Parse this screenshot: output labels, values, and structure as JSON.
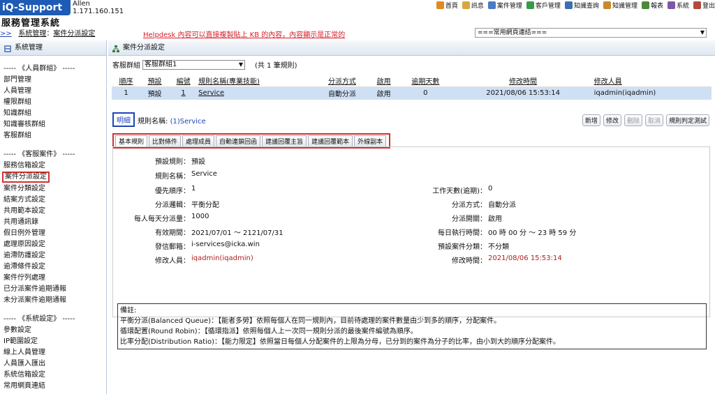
{
  "header": {
    "logo": "iQ-Support",
    "user_name": "Allen",
    "user_ip": "1.171.160.151",
    "app_title": "服務管理系統",
    "breadcrumb": {
      "arrows": ">>",
      "parent": "系統管理",
      "sep": "：",
      "current": "案件分派設定"
    },
    "notice": "Helpdesk 內容可以直接複製貼上 KB 的內容，內容顯示是正常的",
    "quicklinks": "===常用網頁連結===",
    "nav": [
      {
        "label": "首頁",
        "icon": "home-icon",
        "color": "#e08a20"
      },
      {
        "label": "訊息",
        "icon": "mail-icon",
        "color": "#d7a640"
      },
      {
        "label": "案件管理",
        "icon": "case-icon",
        "color": "#4a7bc4"
      },
      {
        "label": "客戶管理",
        "icon": "customer-icon",
        "color": "#3a9a4a"
      },
      {
        "label": "知識查詢",
        "icon": "search-icon",
        "color": "#3b6fb0"
      },
      {
        "label": "知識管理",
        "icon": "knowledge-icon",
        "color": "#c98a2c"
      },
      {
        "label": "報表",
        "icon": "report-icon",
        "color": "#4b8a3a"
      },
      {
        "label": "系統",
        "icon": "system-icon",
        "color": "#7a5aa8"
      },
      {
        "label": "登出",
        "icon": "logout-icon",
        "color": "#b04a3a"
      }
    ]
  },
  "sidebar": {
    "title": "系統管理",
    "groups": [
      {
        "title": "----- 《人員群組》 -----",
        "items": [
          "部門管理",
          "人員管理",
          "權限群組",
          "知識群組",
          "知識審核群組",
          "客服群組"
        ]
      },
      {
        "title": "----- 《客服案件》 -----",
        "items": [
          "服務信箱設定",
          "案件分派設定",
          "案件分類設定",
          "結案方式設定",
          "共用範本設定",
          "共用通訊錄",
          "假日例外管理",
          "處理原因設定",
          "逾滯防護設定",
          "逾滯條件設定",
          "案件佇列處理",
          "已分派案件逾期通報",
          "未分派案件逾期通報"
        ]
      },
      {
        "title": "----- 《系統設定》 -----",
        "items": [
          "參數設定",
          "IP範圍設定",
          "線上人員管理",
          "人員匯入匯出",
          "系統信箱設定",
          "常用網頁連結"
        ]
      }
    ],
    "active_item": "案件分派設定"
  },
  "main": {
    "title": "案件分派設定",
    "filter": {
      "label": "客服群組",
      "value": "客服群組1",
      "count_text": "(共  1  筆規則)"
    },
    "table": {
      "headers": [
        "順序",
        "預設",
        "編號",
        "規則名稱(專業技能)",
        "分派方式",
        "啟用",
        "逾期天數",
        "修改時間",
        "修改人員"
      ],
      "rows": [
        [
          "1",
          "預設",
          "1",
          "Service",
          "自動分派",
          "啟用",
          "0",
          "2021/08/06 15:53:14",
          "iqadmin(iqadmin)"
        ]
      ]
    },
    "detail_tab": "明細",
    "rule_name_label": "規則名稱:",
    "rule_name_value": "(1)Service",
    "actions": [
      {
        "label": "新增",
        "enabled": true
      },
      {
        "label": "修改",
        "enabled": true
      },
      {
        "label": "刪除",
        "enabled": false
      },
      {
        "label": "取消",
        "enabled": false
      },
      {
        "label": "規則判定測試",
        "enabled": true
      }
    ],
    "tabs": [
      "基本規則",
      "比對條件",
      "處理成員",
      "自動連鎖回函",
      "建議回覆主旨",
      "建議回覆範本",
      "外線副本"
    ],
    "fields_left": [
      {
        "label": "預設規則：",
        "value": "預設"
      },
      {
        "label": "規則名稱：",
        "value": "Service"
      },
      {
        "label": "優先順序：",
        "value": "1"
      },
      {
        "label": "分派邏輯：",
        "value": "平衡分配"
      },
      {
        "label": "每人每天分派量：",
        "value": "1000"
      },
      {
        "label": "有效期間：",
        "value": "2021/07/01 ～ 2121/07/31"
      },
      {
        "label": "發信郵箱：",
        "value": "i-services@icka.win"
      },
      {
        "label": "修改人員：",
        "value": "iqadmin(iqadmin)"
      }
    ],
    "fields_right": [
      {
        "label": "工作天數(逾期)：",
        "value": "0"
      },
      {
        "label": "分派方式：",
        "value": "自動分派"
      },
      {
        "label": "分派開關：",
        "value": "啟用"
      },
      {
        "label": "每日執行時間：",
        "value": "00 時 00 分 ～ 23 時 59 分"
      },
      {
        "label": "預設案件分類：",
        "value": "不分類"
      },
      {
        "label": "修改時間：",
        "value": "2021/08/06 15:53:14"
      }
    ],
    "remarks": [
      "備註:",
      "平衡分派(Balanced Queue)：【能者多勞】依照每個人在同一規則內，目前待處理的案件數量由少到多的順序，分配案件。",
      "循環配置(Round Robin)：【循環指派】依照每個人上一次同一規則分派的最後案件編號為順序。",
      "比率分配(Distribution Ratio)：【能力限定】依照當日每個人分配案件的上限為分母，已分到的案件為分子的比率，由小到大的順序分配案件。"
    ]
  }
}
